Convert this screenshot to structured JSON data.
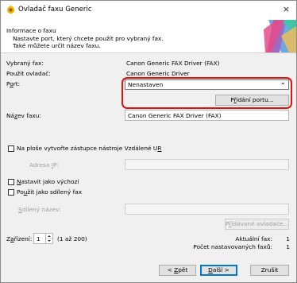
{
  "window": {
    "title": "Ovladač faxu Generic",
    "close_glyph": "×"
  },
  "header": {
    "title": "Informace o faxu",
    "desc_line1": "Nastavte port, který chcete použít pro vybraný fax.",
    "desc_line2": "Také můžete určit název faxu."
  },
  "info": {
    "selected_fax_label": "Vybraný fax:",
    "selected_fax_value": "Canon Generic FAX Driver (FAX)",
    "driver_label": "Použít ovladač:",
    "driver_value": "Canon Generic Driver"
  },
  "port": {
    "label_pre": "P",
    "label_key": "o",
    "label_post": "rt:",
    "selected": "Nenastaven",
    "chevron": "⌄",
    "add_port_pre": "P",
    "add_port_key": "ř",
    "add_port_post": "idání portu..."
  },
  "fax_name": {
    "label_pre": "Ná",
    "label_key": "z",
    "label_post": "ev faxu:",
    "value": "Canon Generic FAX Driver (FAX)"
  },
  "remote_ui": {
    "checkbox_pre": "Na ploše vytvořte zástupce nástroje Vzdálené U",
    "checkbox_key": "R",
    "checked": false,
    "ip_label_pre": "Adresa ",
    "ip_label_key": "I",
    "ip_label_post": "P:",
    "ip_value": ""
  },
  "options": {
    "default_pre": "",
    "default_key": "N",
    "default_post": "astavit jako výchozí",
    "default_checked": false,
    "shared_pre": "Po",
    "shared_key": "u",
    "shared_post": "žít jako sdílený fax",
    "shared_checked": false,
    "shared_name_pre": "",
    "shared_name_key": "S",
    "shared_name_post": "dílený název:",
    "shared_name_value": "",
    "additional_pre": "P",
    "additional_key": "ř",
    "additional_post": "idávané ovladače..."
  },
  "devices": {
    "label_pre": "Z",
    "label_key": "a",
    "label_post": "řízení:",
    "value": "1",
    "range": "(1 až 200)",
    "current_fax_label": "Aktuální fax:",
    "current_fax_value": "1",
    "set_faxes_label": "Počet nastavovaných faxů:",
    "set_faxes_value": "1"
  },
  "buttons": {
    "back_pre": "< ",
    "back_key": "Z",
    "back_post": "pět",
    "next_pre": "",
    "next_key": "D",
    "next_post": "alší >",
    "cancel": "Zrušit"
  },
  "colors": {
    "highlight_ring": "#e3120b",
    "primary_border": "#0078d7"
  }
}
